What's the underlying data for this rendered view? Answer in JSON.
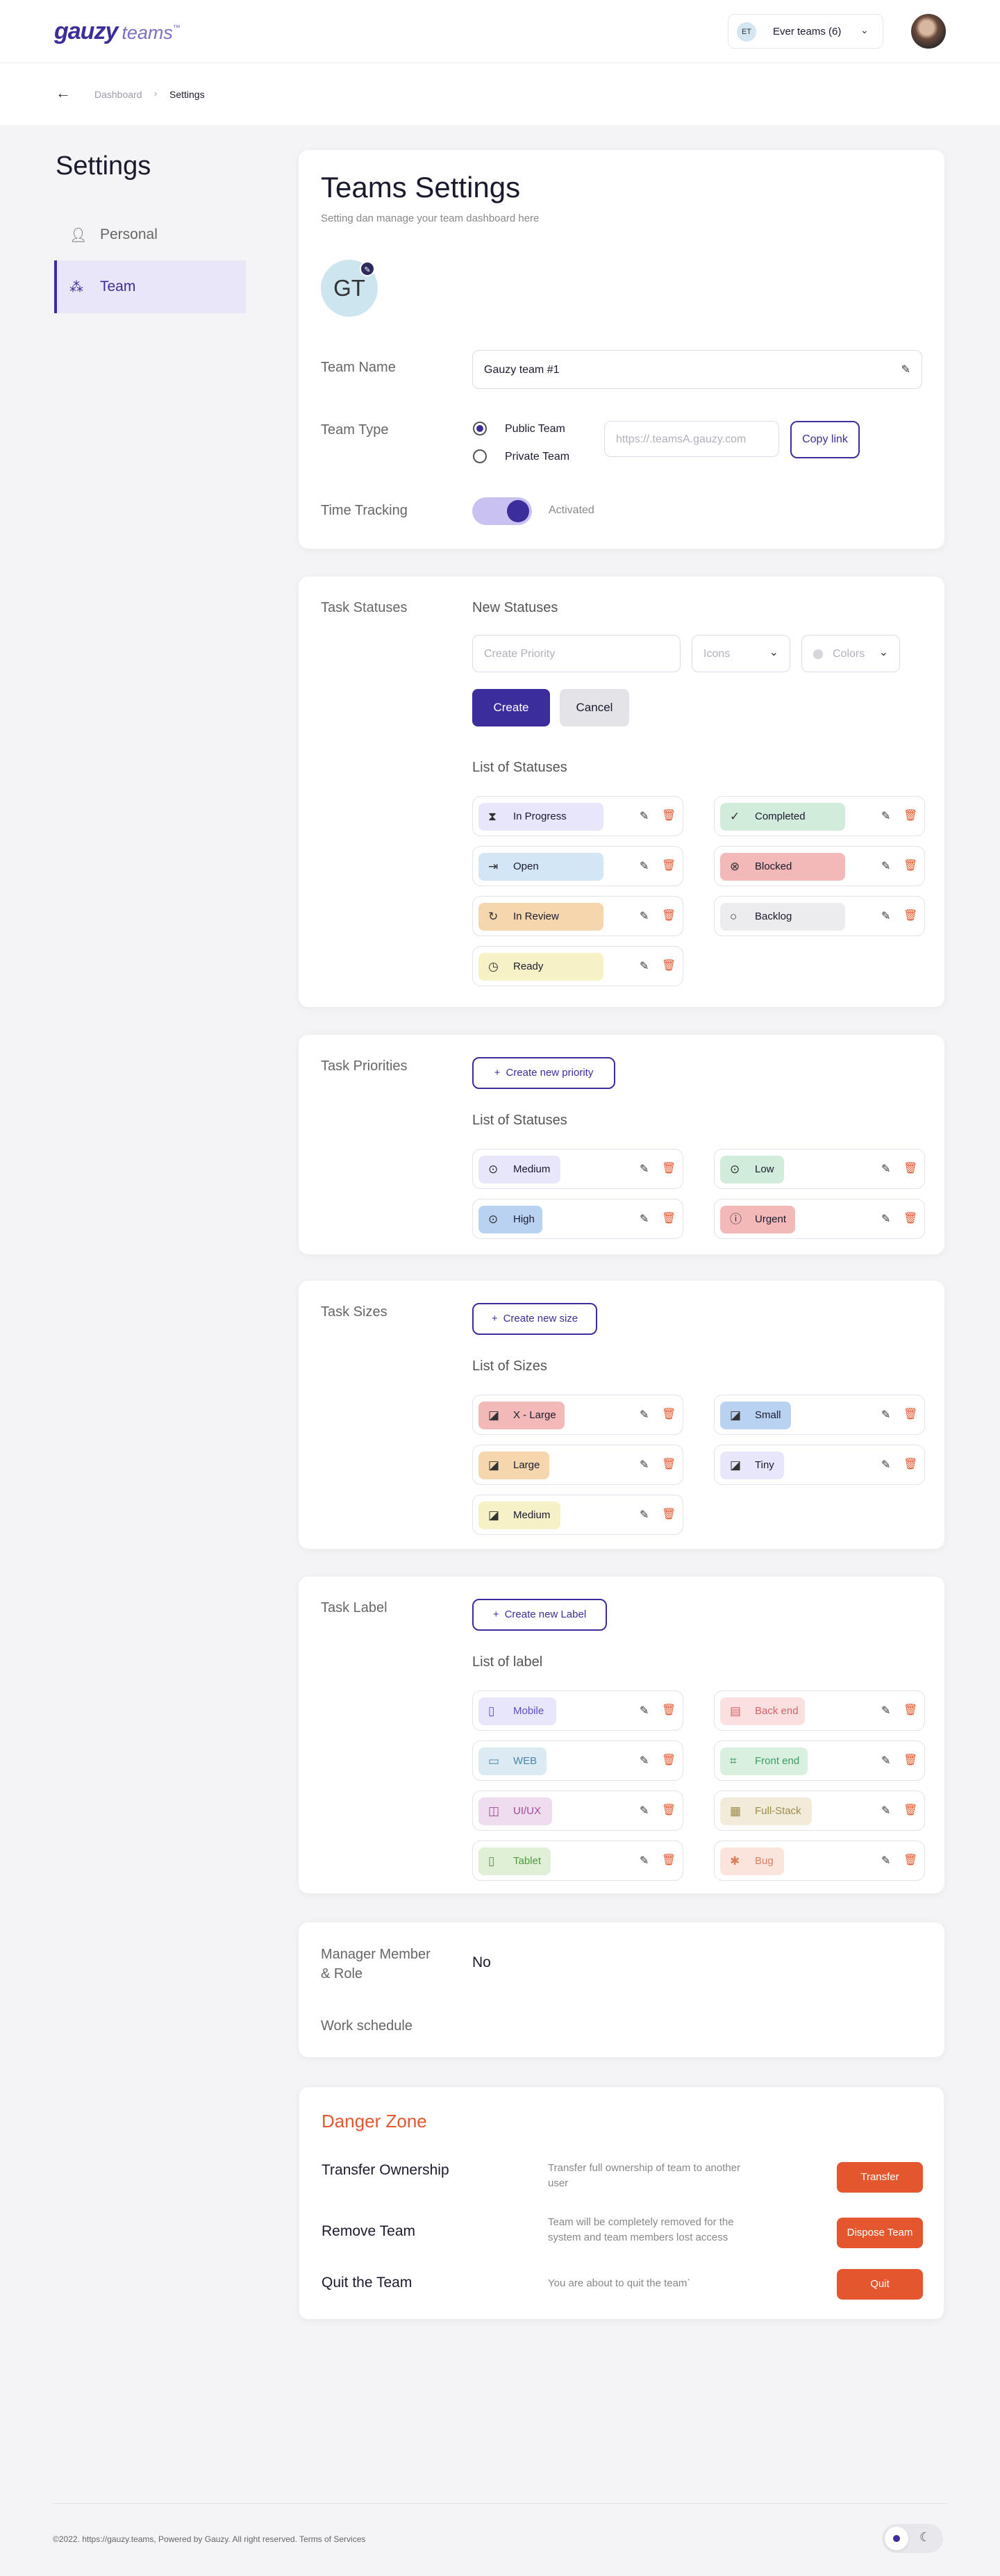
{
  "header": {
    "logo_main": "gauzy",
    "logo_sub": "teams",
    "logo_tm": "™",
    "team_initials": "ET",
    "team_selector": "Ever teams (6)"
  },
  "breadcrumb": {
    "parent": "Dashboard",
    "current": "Settings"
  },
  "sidebar": {
    "title": "Settings",
    "items": [
      {
        "label": "Personal",
        "icon": "user-icon"
      },
      {
        "label": "Team",
        "icon": "users-icon"
      }
    ]
  },
  "teams_settings": {
    "title": "Teams Settings",
    "subtitle": "Setting dan manage your team dashboard here",
    "avatar_initials": "GT",
    "team_name_label": "Team Name",
    "team_name_value": "Gauzy team #1",
    "team_type_label": "Team Type",
    "public_label": "Public Team",
    "private_label": "Private Team",
    "link_placeholder": "https://.teamsA.gauzy.com",
    "copy_link": "Copy link",
    "time_tracking_label": "Time Tracking",
    "time_tracking_status": "Activated"
  },
  "task_statuses": {
    "label": "Task Statuses",
    "new_heading": "New Statuses",
    "create_placeholder": "Create Priority",
    "icons_select": "Icons",
    "colors_select": "Colors",
    "create_button": "Create",
    "cancel_button": "Cancel",
    "list_heading": "List of Statuses",
    "items": [
      {
        "label": "In Progress",
        "color": "#e8e6fb",
        "icon": "hourglass-icon"
      },
      {
        "label": "Completed",
        "color": "#d2ecdc",
        "icon": "check-circle-icon"
      },
      {
        "label": "Open",
        "color": "#d2e6f6",
        "icon": "login-icon"
      },
      {
        "label": "Blocked",
        "color": "#f3b9b9",
        "icon": "x-circle-icon"
      },
      {
        "label": "In Review",
        "color": "#f6d7ad",
        "icon": "refresh-icon"
      },
      {
        "label": "Backlog",
        "color": "#ececee",
        "icon": "circle-icon"
      },
      {
        "label": "Ready",
        "color": "#f6f1c6",
        "icon": "clock-icon"
      }
    ]
  },
  "task_priorities": {
    "label": "Task Priorities",
    "create_button": "Create new priority",
    "list_heading": "List of Statuses",
    "items": [
      {
        "label": "Medium",
        "color": "#e8e6fb",
        "icon": "arrow-circle-icon"
      },
      {
        "label": "Low",
        "color": "#d2ecdc",
        "icon": "arrow-circle-icon"
      },
      {
        "label": "High",
        "color": "#b9d2f1",
        "icon": "arrow-circle-icon"
      },
      {
        "label": "Urgent",
        "color": "#f3b9b9",
        "icon": "alert-circle-icon"
      }
    ]
  },
  "task_sizes": {
    "label": "Task Sizes",
    "create_button": "Create new size",
    "list_heading": "List of Sizes",
    "items": [
      {
        "label": "X - Large",
        "color": "#f3b9b9",
        "icon": "size-icon"
      },
      {
        "label": "Small",
        "color": "#b9d2f1",
        "icon": "size-icon"
      },
      {
        "label": "Large",
        "color": "#f6d7ad",
        "icon": "size-icon"
      },
      {
        "label": "Tiny",
        "color": "#e8e6fb",
        "icon": "size-icon"
      },
      {
        "label": "Medium",
        "color": "#f6f1c6",
        "icon": "size-icon"
      }
    ]
  },
  "task_label": {
    "label": "Task Label",
    "create_button": "Create new Label",
    "list_heading": "List of label",
    "items": [
      {
        "label": "Mobile",
        "color": "#e8e6fb",
        "text_color": "#5a4fc4",
        "icon": "mobile-icon"
      },
      {
        "label": "Back end",
        "color": "#fbe0e0",
        "text_color": "#d6616b",
        "icon": "server-icon"
      },
      {
        "label": "WEB",
        "color": "#dceaf3",
        "text_color": "#4a86a8",
        "icon": "monitor-icon"
      },
      {
        "label": "Front end",
        "color": "#d9f0e1",
        "text_color": "#3f9a64",
        "icon": "code-icon"
      },
      {
        "label": "UI/UX",
        "color": "#f0dcef",
        "text_color": "#9c4a96",
        "icon": "design-icon"
      },
      {
        "label": "Full-Stack",
        "color": "#f1ecd9",
        "text_color": "#9d8a4a",
        "icon": "stack-icon"
      },
      {
        "label": "Tablet",
        "color": "#dff0d6",
        "text_color": "#4f9a3c",
        "icon": "tablet-icon"
      },
      {
        "label": "Bug",
        "color": "#fbe4dc",
        "text_color": "#d98060",
        "icon": "bug-icon"
      }
    ]
  },
  "manager": {
    "label_line1": "Manager Member",
    "label_line2": "& Role",
    "value": "No",
    "work_schedule": "Work schedule"
  },
  "danger_zone": {
    "title": "Danger Zone",
    "items": [
      {
        "label": "Transfer Ownership",
        "desc": "Transfer full ownership of team to another user",
        "button": "Transfer"
      },
      {
        "label": "Remove Team",
        "desc": "Team will be completely removed for the system and team members lost access",
        "button": "Dispose Team"
      },
      {
        "label": "Quit the Team",
        "desc": "You are about to quit the team`",
        "button": "Quit"
      }
    ]
  },
  "footer": {
    "copyright": "©2022. https://gauzy.teams, Powered by Gauzy. All right reserved. Terms of Services"
  }
}
